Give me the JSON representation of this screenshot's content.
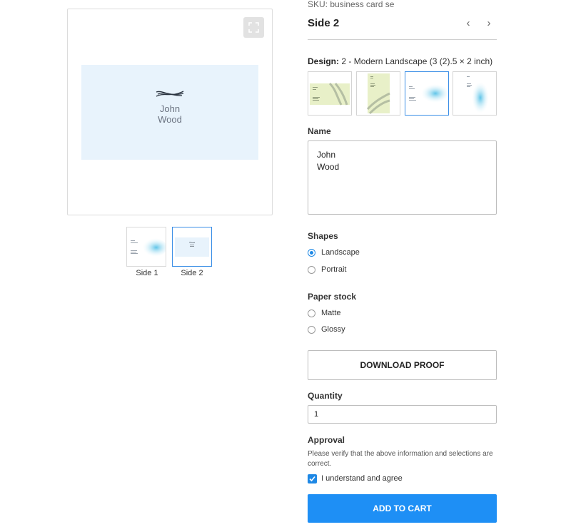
{
  "preview": {
    "card_name": "John\nWood",
    "expand_icon": "expand-icon"
  },
  "sides": [
    {
      "label": "Side 1"
    },
    {
      "label": "Side 2",
      "active": true
    }
  ],
  "product": {
    "sku": "SKU: business card se",
    "side_title": "Side 2",
    "prev_icon": "chevron-left-icon",
    "next_icon": "chevron-right-icon",
    "prev_label": "‹",
    "next_label": "›"
  },
  "design": {
    "label": "Design:",
    "value": "2 - Modern Landscape (3 (2).5 × 2 inch)",
    "selected_index": 2
  },
  "name_field": {
    "label": "Name",
    "value": "John\nWood"
  },
  "shapes": {
    "label": "Shapes",
    "options": [
      "Landscape",
      "Portrait"
    ],
    "selected": "Landscape"
  },
  "paper_stock": {
    "label": "Paper stock",
    "options": [
      "Matte",
      "Glossy"
    ],
    "selected": ""
  },
  "download_proof": "DOWNLOAD PROOF",
  "quantity": {
    "label": "Quantity",
    "value": "1"
  },
  "approval": {
    "label": "Approval",
    "text": "Please verify that the above information and selections are correct.",
    "checkbox_label": "I understand and agree",
    "checked": true
  },
  "add_to_cart": "ADD TO CART",
  "colors": {
    "accent": "#1e8ff5",
    "card_blue": "#e8f3fc",
    "green_card": "#e8f0c8"
  }
}
